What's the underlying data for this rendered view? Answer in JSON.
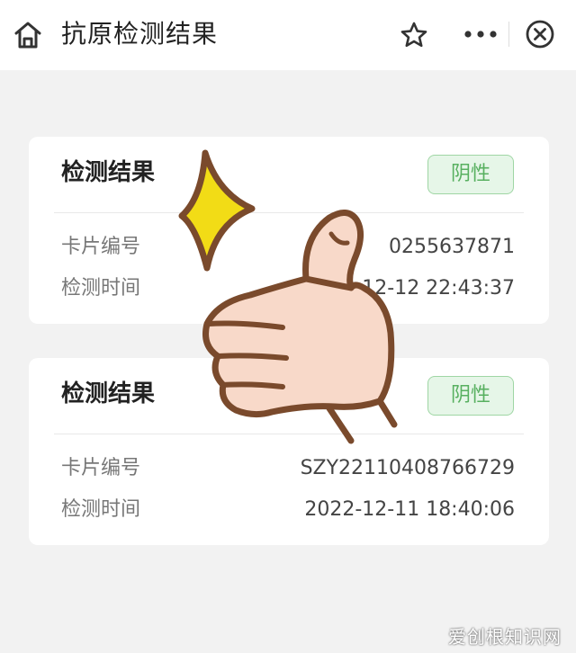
{
  "header": {
    "title": "抗原检测结果",
    "icons": [
      "home-icon",
      "star-icon",
      "more-icon",
      "close-icon"
    ]
  },
  "results": [
    {
      "title": "检测结果",
      "status": "阴性",
      "card_label": "卡片编号",
      "card_number": "S          0255637871",
      "time_label": "检测时间",
      "time_value": "2-12-12 22:43:37"
    },
    {
      "title": "检测结果",
      "status": "阴性",
      "card_label": "卡片编号",
      "card_number": "SZY22110408766729",
      "time_label": "检测时间",
      "time_value": "2022-12-11 18:40:06"
    }
  ],
  "watermark": "爱创根知识网",
  "colors": {
    "page_bg": "#f2f2f2",
    "badge_green": "#58b060",
    "badge_bg": "#e6f6e8",
    "sticker_outline": "#7a4a2c",
    "sticker_skin": "#f8d9c9",
    "sparkle": "#f2dc16"
  }
}
